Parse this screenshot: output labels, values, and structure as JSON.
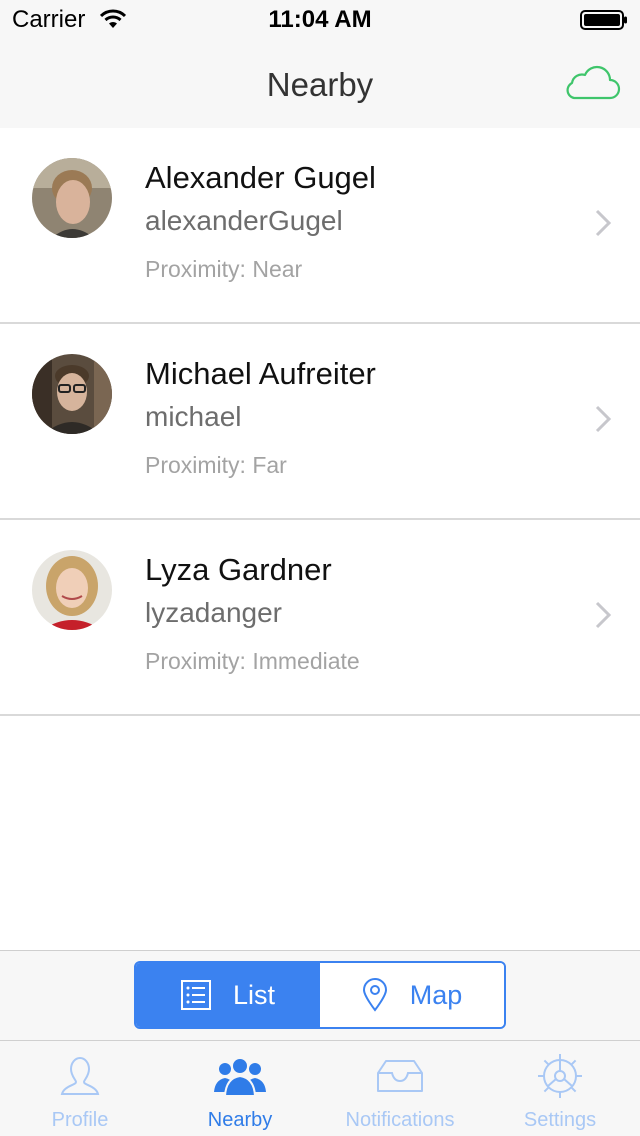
{
  "status_bar": {
    "carrier": "Carrier",
    "time": "11:04 AM"
  },
  "nav": {
    "title": "Nearby",
    "right_icon": "cloud-icon",
    "accent_color": "#3fc56b"
  },
  "users": [
    {
      "name": "Alexander Gugel",
      "username": "alexanderGugel",
      "proximity": "Proximity: Near"
    },
    {
      "name": "Michael Aufreiter",
      "username": "michael",
      "proximity": "Proximity: Far"
    },
    {
      "name": "Lyza Gardner",
      "username": "lyzadanger",
      "proximity": "Proximity: Immediate"
    }
  ],
  "segment": {
    "options": [
      {
        "label": "List",
        "icon": "list-icon",
        "selected": true
      },
      {
        "label": "Map",
        "icon": "map-pin-icon",
        "selected": false
      }
    ],
    "color": "#3b82f0"
  },
  "tabs": [
    {
      "label": "Profile",
      "icon": "person-icon",
      "active": false
    },
    {
      "label": "Nearby",
      "icon": "group-icon",
      "active": true
    },
    {
      "label": "Notifications",
      "icon": "inbox-icon",
      "active": false
    },
    {
      "label": "Settings",
      "icon": "gear-icon",
      "active": false
    }
  ]
}
